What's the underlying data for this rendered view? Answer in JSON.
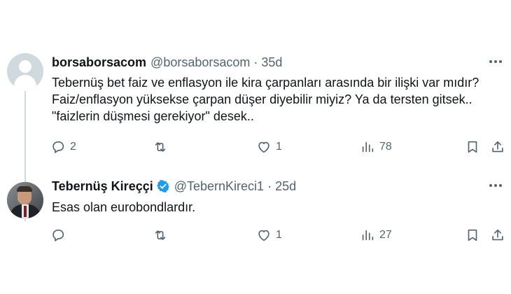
{
  "tweets": [
    {
      "name": "borsaborsacom",
      "handle": "@borsaborsacom",
      "separator": "·",
      "time": "35d",
      "verified": false,
      "lines": [
        "Tebernüş bet faiz ve enflasyon ile kira çarpanları arasında bir ilişki var mıdır?",
        "Faiz/enflasyon yüksekse çarpan düşer diyebilir miyiz? Ya da tersten gitsek..",
        "\"faizlerin düşmesi gerekiyor\" desek.."
      ],
      "replies": "2",
      "retweets": "",
      "likes": "1",
      "views": "78"
    },
    {
      "name": "Tebernüş Kireççi",
      "handle": "@TebernKireci1",
      "separator": "·",
      "time": "25d",
      "verified": true,
      "lines": [
        "Esas olan eurobondlardır."
      ],
      "replies": "",
      "retweets": "",
      "likes": "1",
      "views": "27"
    }
  ],
  "icons": {
    "more": "more-horizontal-icon",
    "reply": "reply-icon",
    "retweet": "retweet-icon",
    "like": "heart-icon",
    "views": "views-chart-icon",
    "bookmark": "bookmark-icon",
    "share": "share-icon",
    "verified": "verified-badge-icon"
  },
  "colors": {
    "text": "#0f1419",
    "secondary": "#536471",
    "verified": "#1d9bf0",
    "thread_line": "#cfd9de"
  }
}
